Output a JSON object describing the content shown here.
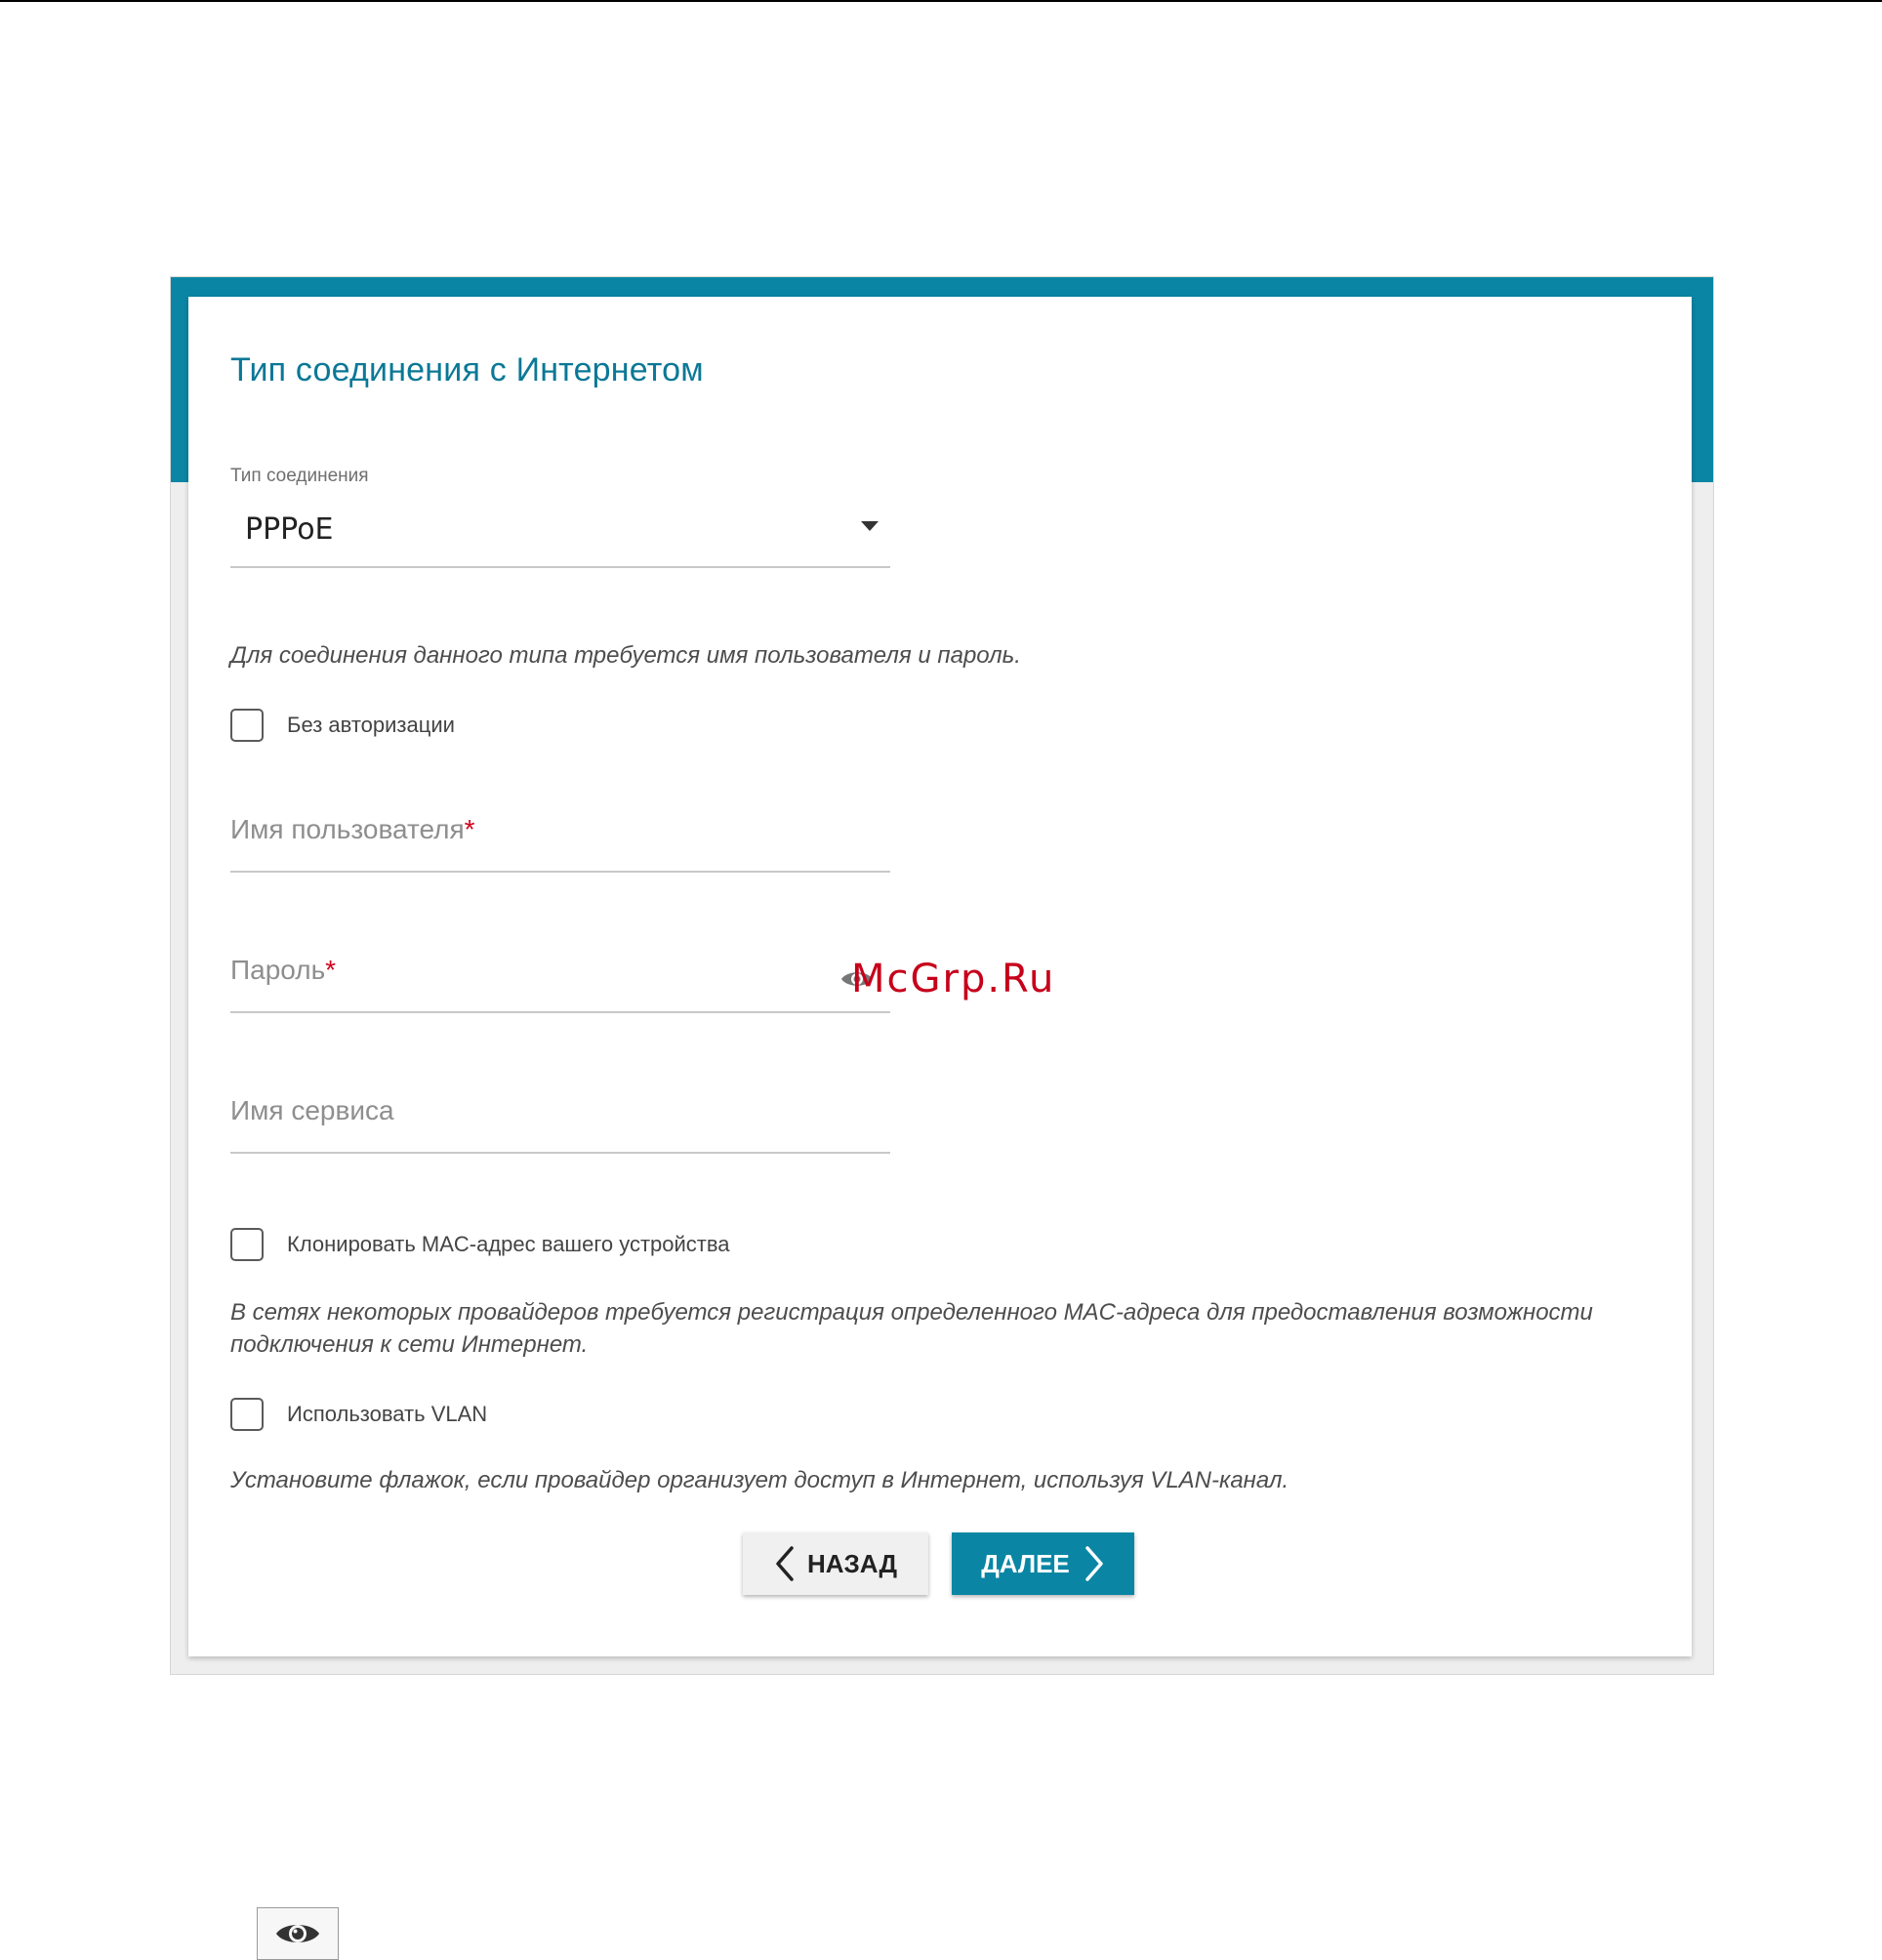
{
  "wizard": {
    "title": "Тип соединения с Интернетом",
    "connection_type": {
      "label": "Тип соединения",
      "selected": "PPPoE"
    },
    "auth_hint": "Для соединения данного типа требуется имя пользователя и пароль.",
    "no_auth": {
      "label": "Без авторизации",
      "checked": false
    },
    "username": {
      "label": "Имя пользователя",
      "required_mark": "*",
      "value": ""
    },
    "password": {
      "label": "Пароль",
      "required_mark": "*",
      "value": ""
    },
    "service_name": {
      "label": "Имя сервиса",
      "value": ""
    },
    "clone_mac": {
      "label": "Клонировать MAC-адрес вашего устройства",
      "checked": false
    },
    "mac_hint": "В сетях некоторых провайдеров требуется регистрация определенного MAC-адреса для предоставления возможности подключения к сети Интернет.",
    "use_vlan": {
      "label": "Использовать VLAN",
      "checked": false
    },
    "vlan_hint": "Установите флажок, если провайдер организует доступ в Интернет, используя VLAN-канал.",
    "back_label": "НАЗАД",
    "next_label": "ДАЛЕЕ"
  },
  "watermark": "McGrp.Ru",
  "icons": {
    "password_toggle": "eye-icon",
    "legend": "eye-icon"
  },
  "colors": {
    "accent": "#0a86a4",
    "title": "#0b7896",
    "required": "#d0021b",
    "watermark": "#c7001a"
  }
}
